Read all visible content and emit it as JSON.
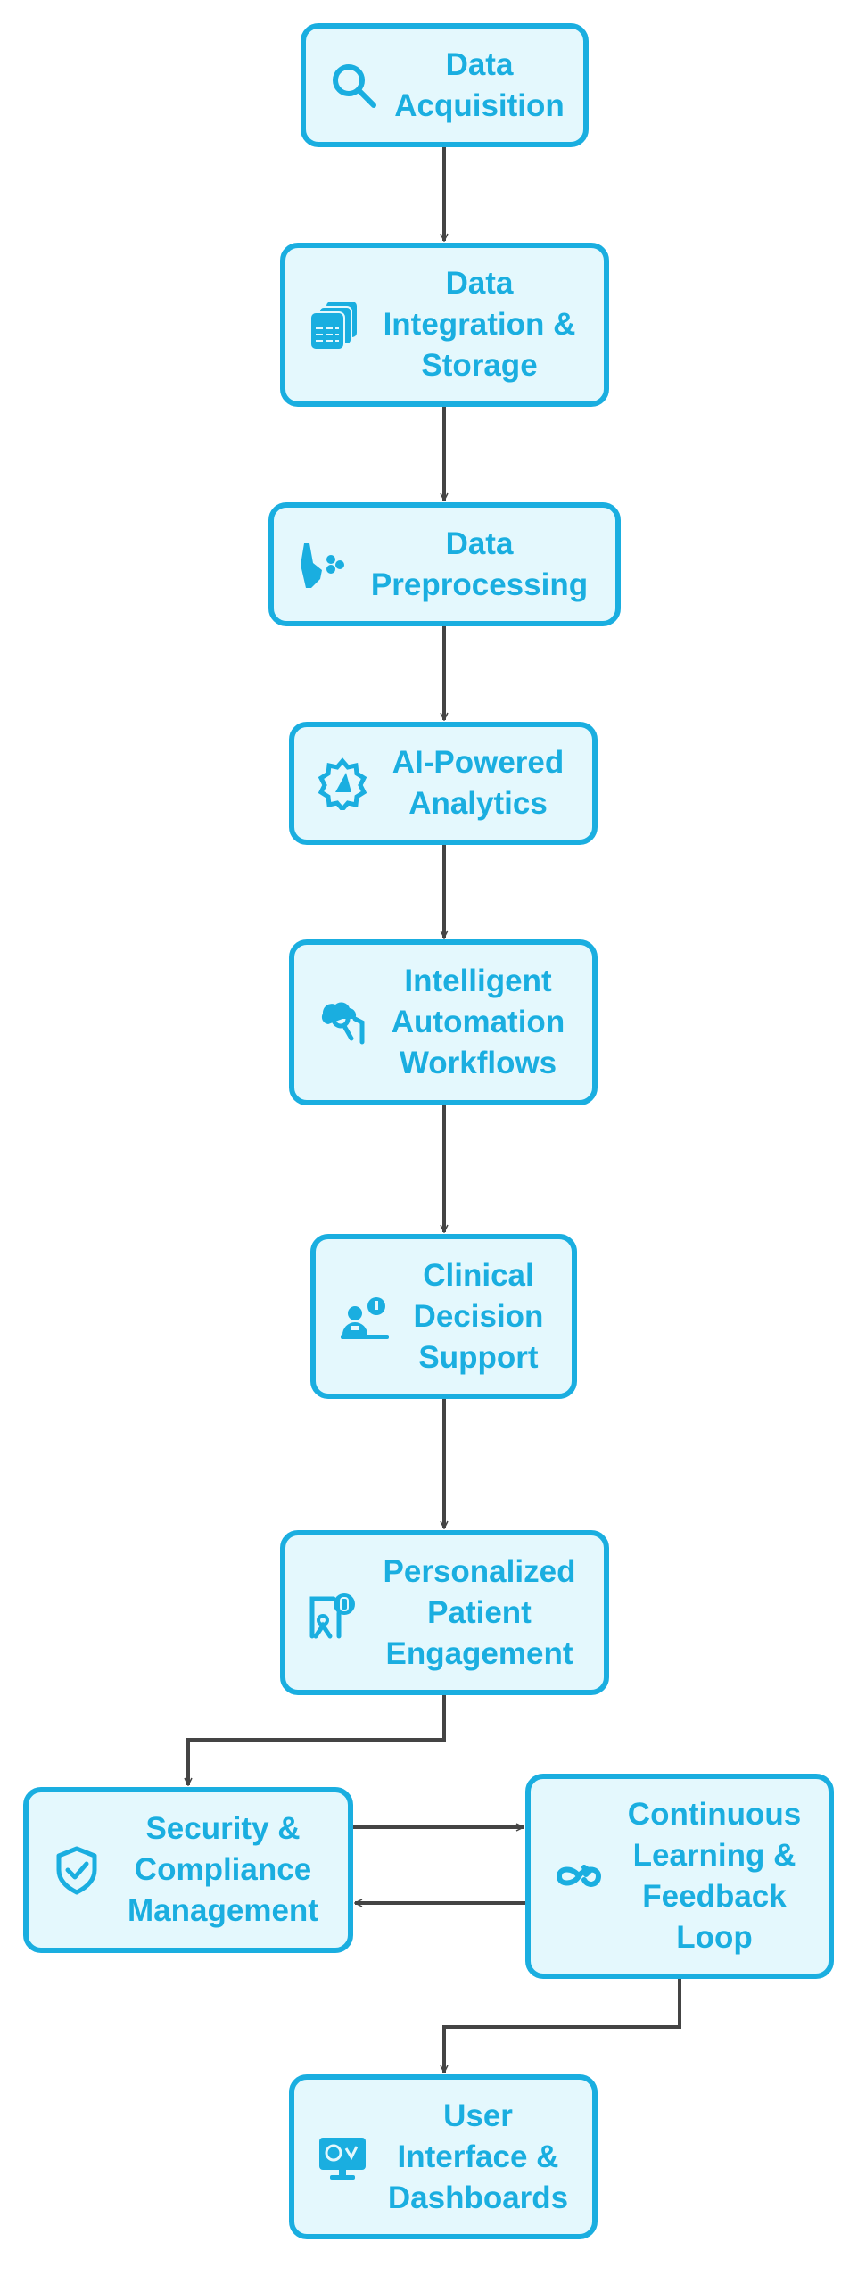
{
  "diagram": {
    "type": "flowchart",
    "colors": {
      "node_border": "#1aaee0",
      "node_fill": "#e4f8fd",
      "text": "#1aaee0",
      "edge": "#444444"
    },
    "nodes": [
      {
        "id": "n1",
        "label": "Data Acquisition",
        "icon": "search-icon"
      },
      {
        "id": "n2",
        "label": "Data Integration & Storage",
        "icon": "database-stack-icon"
      },
      {
        "id": "n3",
        "label": "Data Preprocessing",
        "icon": "broom-icon"
      },
      {
        "id": "n4",
        "label": "AI-Powered Analytics",
        "icon": "ai-gear-icon"
      },
      {
        "id": "n5",
        "label": "Intelligent Automation Workflows",
        "icon": "brain-gear-icon"
      },
      {
        "id": "n6",
        "label": "Clinical Decision Support",
        "icon": "doctor-consult-icon"
      },
      {
        "id": "n7",
        "label": "Personalized Patient Engagement",
        "icon": "patient-chat-icon"
      },
      {
        "id": "n8",
        "label": "Security & Compliance Management",
        "icon": "shield-check-icon"
      },
      {
        "id": "n9",
        "label": "Continuous Learning & Feedback Loop",
        "icon": "infinity-loop-icon"
      },
      {
        "id": "n10",
        "label": "User Interface & Dashboards",
        "icon": "monitor-dashboard-icon"
      }
    ],
    "edges": [
      {
        "from": "n1",
        "to": "n2"
      },
      {
        "from": "n2",
        "to": "n3"
      },
      {
        "from": "n3",
        "to": "n4"
      },
      {
        "from": "n4",
        "to": "n5"
      },
      {
        "from": "n5",
        "to": "n6"
      },
      {
        "from": "n6",
        "to": "n7"
      },
      {
        "from": "n7",
        "to": "n8"
      },
      {
        "from": "n8",
        "to": "n9"
      },
      {
        "from": "n9",
        "to": "n8"
      },
      {
        "from": "n9",
        "to": "n10"
      }
    ]
  }
}
